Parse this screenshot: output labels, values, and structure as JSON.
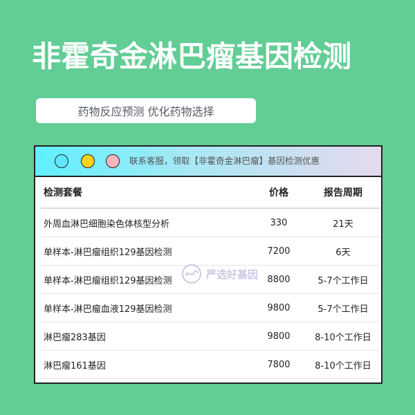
{
  "header": {
    "title": "非霍奇金淋巴瘤基因检测",
    "subtitle": "药物反应预测 优化药物选择"
  },
  "window": {
    "contact_text": "联系客服，领取【非霍奇金淋巴瘤】基因检测优惠",
    "dot_colors": [
      "#5fe8ff",
      "#ffd21e",
      "#f7b5c0"
    ]
  },
  "table": {
    "headers": [
      "检测套餐",
      "价格",
      "报告周期"
    ],
    "rows": [
      {
        "name": "外周血淋巴细胞染色体核型分析",
        "price": "330",
        "period": "21天"
      },
      {
        "name": "单样本-淋巴瘤组织129基因检测",
        "price": "7200",
        "period": "6天"
      },
      {
        "name": "单样本-淋巴瘤组织129基因检测",
        "price": "8800",
        "period": "5-7个工作日"
      },
      {
        "name": "单样本-淋巴瘤血液129基因检测",
        "price": "9800",
        "period": "5-7个工作日"
      },
      {
        "name": "淋巴瘤283基因",
        "price": "9800",
        "period": "8-10个工作日"
      },
      {
        "name": "淋巴瘤161基因",
        "price": "7800",
        "period": "8-10个工作日"
      }
    ]
  },
  "watermark": {
    "text": "严选好基因",
    "icon": "dna-logo-icon"
  },
  "colors": {
    "background": "#62cd95",
    "title_text": "#ffffff"
  }
}
